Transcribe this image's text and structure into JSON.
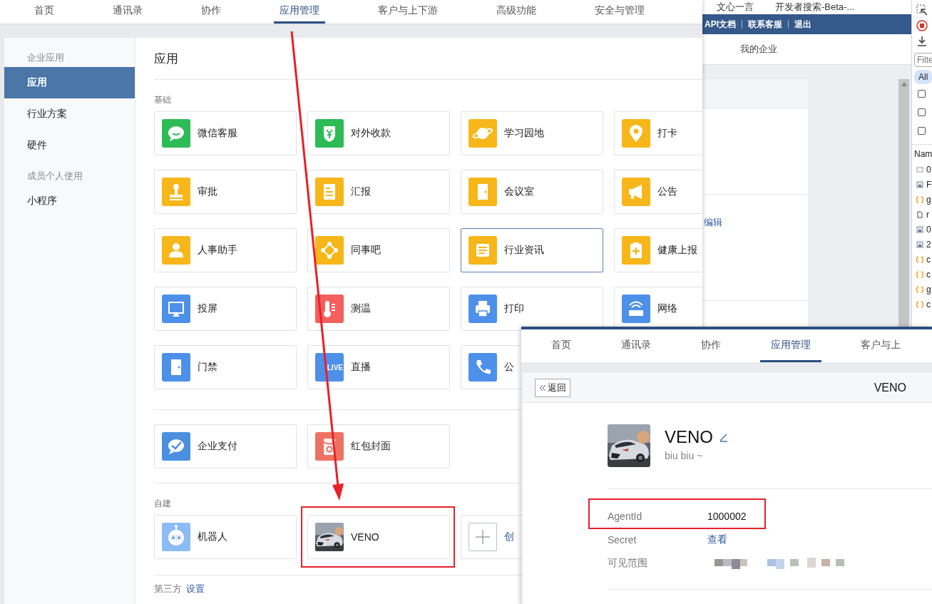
{
  "browser_behind": {
    "bookmarks": [
      "文心一言",
      "开发者搜索-Beta-..."
    ],
    "header_links": [
      "API文档",
      "联系客服",
      "退出"
    ],
    "nav_item": "我的企业",
    "edit_link": "编辑"
  },
  "devtools": {
    "filter_placeholder": "Filte",
    "filter_chip": "All",
    "checkboxes": [
      {
        "checked": false
      },
      {
        "checked": false
      },
      {
        "checked": false
      }
    ],
    "column_header": "Nam",
    "rows": [
      "0",
      "F",
      "g",
      "r",
      "0",
      "2",
      "c",
      "c",
      "g",
      "c"
    ]
  },
  "main_window": {
    "nav_tabs": [
      {
        "label": "首页",
        "selected": false
      },
      {
        "label": "通讯录",
        "selected": false
      },
      {
        "label": "协作",
        "selected": false
      },
      {
        "label": "应用管理",
        "selected": true
      },
      {
        "label": "客户与上下游",
        "selected": false
      },
      {
        "label": "高级功能",
        "selected": false
      },
      {
        "label": "安全与管理",
        "selected": false
      }
    ],
    "sidebar": [
      {
        "kind": "group",
        "label": "企业应用"
      },
      {
        "kind": "item",
        "label": "应用",
        "selected": true
      },
      {
        "kind": "item",
        "label": "行业方案",
        "selected": false
      },
      {
        "kind": "item",
        "label": "硬件",
        "selected": false
      },
      {
        "kind": "group",
        "label": "成员个人使用"
      },
      {
        "kind": "item",
        "label": "小程序",
        "selected": false
      }
    ],
    "title": "应用",
    "sections": [
      {
        "heading": "基础",
        "apps": [
          {
            "kind": "icon",
            "label": "微信客服",
            "color": "#2dbb55",
            "selected": false
          },
          {
            "kind": "icon",
            "label": "对外收款",
            "color": "#2dbb55",
            "selected": false
          },
          {
            "kind": "icon",
            "label": "学习园地",
            "color": "#f7b619",
            "selected": false
          },
          {
            "kind": "icon",
            "label": "打卡",
            "color": "#f7b619",
            "selected": false
          },
          {
            "kind": "icon",
            "label": "审批",
            "color": "#f7b619",
            "selected": false
          },
          {
            "kind": "icon",
            "label": "汇报",
            "color": "#f7b619",
            "selected": false
          },
          {
            "kind": "icon",
            "label": "会议室",
            "color": "#f7b619",
            "selected": false
          },
          {
            "kind": "icon",
            "label": "公告",
            "color": "#f7b619",
            "selected": false
          },
          {
            "kind": "icon",
            "label": "人事助手",
            "color": "#f7b619",
            "selected": false
          },
          {
            "kind": "icon",
            "label": "同事吧",
            "color": "#f7b619",
            "selected": false
          },
          {
            "kind": "icon",
            "label": "行业资讯",
            "color": "#f7b619",
            "selected": true
          },
          {
            "kind": "icon",
            "label": "健康上报",
            "color": "#f7b619",
            "selected": false
          },
          {
            "kind": "icon",
            "label": "投屏",
            "color": "#4d90ea",
            "selected": false
          },
          {
            "kind": "icon",
            "label": "测温",
            "color": "#f25f5c",
            "selected": false
          },
          {
            "kind": "icon",
            "label": "打印",
            "color": "#4d90ea",
            "selected": false
          },
          {
            "kind": "icon",
            "label": "网络",
            "color": "#4d90ea",
            "selected": false
          },
          {
            "kind": "icon",
            "label": "门禁",
            "color": "#4d90ea",
            "selected": false
          },
          {
            "kind": "icon",
            "label": "直播",
            "color": "#4d90ea",
            "selected": false,
            "badge": "LIVE"
          },
          {
            "kind": "icon",
            "label": "公",
            "color": "#4d90ea",
            "selected": false
          }
        ]
      },
      {
        "apps": [
          {
            "kind": "icon",
            "label": "企业支付",
            "color": "#4a8fe0",
            "selected": false
          },
          {
            "kind": "icon",
            "label": "红包封面",
            "color": "#ee7262",
            "selected": false
          }
        ]
      },
      {
        "heading": "自建",
        "apps": [
          {
            "kind": "icon",
            "label": "机器人",
            "color": "#8cbcf5",
            "selected": false
          },
          {
            "kind": "picture",
            "label": "VENO",
            "selected": false
          },
          {
            "kind": "add",
            "label": "创",
            "selected": false
          }
        ]
      },
      {
        "heading": "第三方",
        "link": "设置"
      }
    ]
  },
  "detail_window": {
    "nav_tabs": [
      {
        "label": "首页",
        "selected": false
      },
      {
        "label": "通讯录",
        "selected": false
      },
      {
        "label": "协作",
        "selected": false
      },
      {
        "label": "应用管理",
        "selected": true
      },
      {
        "label": "客户与上",
        "selected": false
      }
    ],
    "back_button": "返回",
    "header_title": "VENO",
    "app_name": "VENO",
    "app_description": "biu biu ~",
    "fields": [
      {
        "kind": "text",
        "label": "AgentId",
        "value": "1000002"
      },
      {
        "kind": "link",
        "label": "Secret",
        "value": "查看"
      },
      {
        "kind": "redacted",
        "label": "可见范围"
      }
    ]
  }
}
